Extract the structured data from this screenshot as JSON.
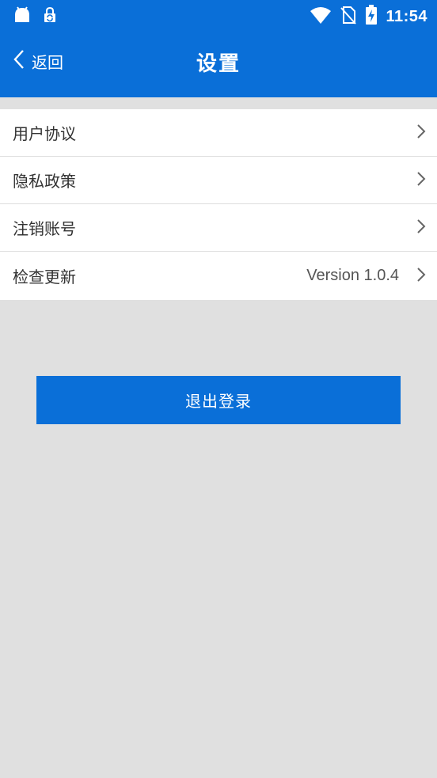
{
  "status_bar": {
    "time": "11:54",
    "icons": [
      "android-icon",
      "lock-sync-icon",
      "wifi-icon",
      "no-sim-icon",
      "battery-charging-icon"
    ]
  },
  "header": {
    "back_label": "返回",
    "title": "设置",
    "color": "#0a6fd8"
  },
  "menu": {
    "items": [
      {
        "label": "用户协议",
        "value": ""
      },
      {
        "label": "隐私政策",
        "value": ""
      },
      {
        "label": "注销账号",
        "value": ""
      },
      {
        "label": "检查更新",
        "value": "Version 1.0.4"
      }
    ]
  },
  "logout": {
    "label": "退出登录"
  }
}
